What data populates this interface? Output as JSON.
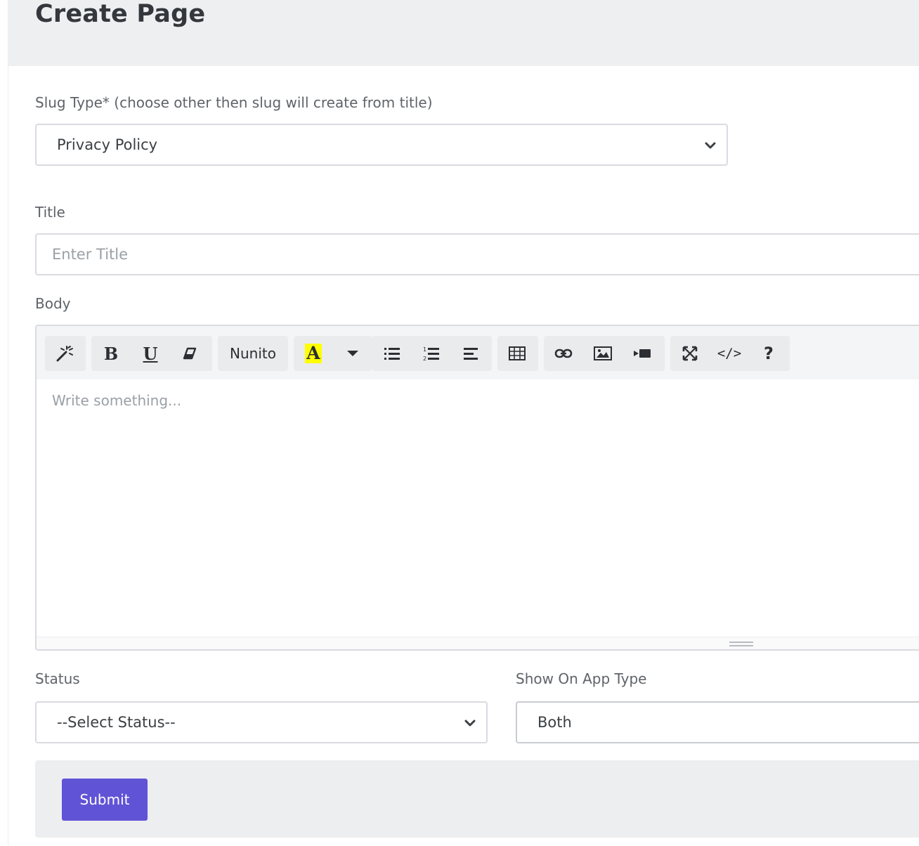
{
  "page": {
    "title": "Create Page"
  },
  "form": {
    "slug_type": {
      "label": "Slug Type* (choose other then slug will create from title)",
      "value": "Privacy Policy"
    },
    "title": {
      "label": "Title",
      "placeholder": "Enter Title"
    },
    "body": {
      "label": "Body",
      "placeholder": "Write something...",
      "toolbar": {
        "style_icon": "magic-wand-icon",
        "bold_label": "B",
        "underline_label": "U",
        "eraser_icon": "eraser-icon",
        "font_name": "Nunito",
        "color_label": "A",
        "highlight_color": "#ffff00",
        "ul_icon": "unordered-list-icon",
        "ol_icon": "ordered-list-icon",
        "align_icon": "align-icon",
        "table_icon": "table-icon",
        "link_icon": "link-icon",
        "picture_icon": "picture-icon",
        "video_icon": "video-icon",
        "fullscreen_icon": "fullscreen-icon",
        "code_label": "</>",
        "help_label": "?"
      }
    },
    "status": {
      "label": "Status",
      "value": "--Select Status--"
    },
    "app_type": {
      "label": "Show On App Type",
      "value": "Both"
    },
    "submit_label": "Submit"
  },
  "colors": {
    "primary": "#6153d6",
    "header_bg": "#eeeff1"
  }
}
